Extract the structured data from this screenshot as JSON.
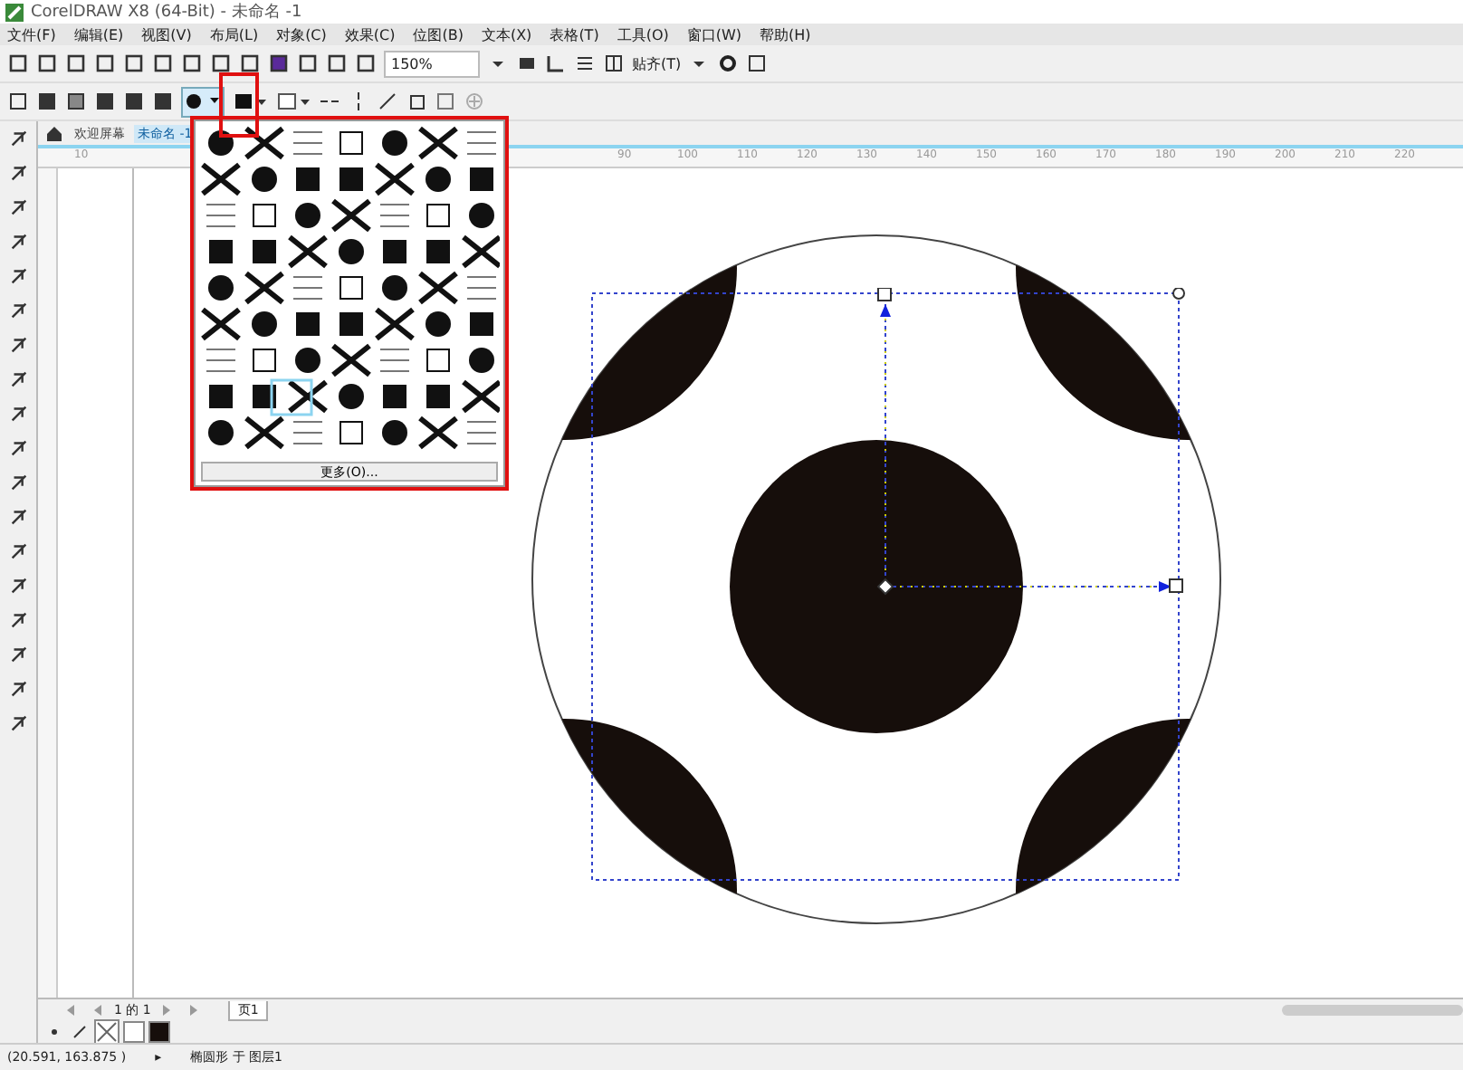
{
  "window": {
    "title": "CorelDRAW X8 (64-Bit) - 未命名 -1"
  },
  "menu": [
    "文件(F)",
    "编辑(E)",
    "视图(V)",
    "布局(L)",
    "对象(C)",
    "效果(C)",
    "位图(B)",
    "文本(X)",
    "表格(T)",
    "工具(O)",
    "窗口(W)",
    "帮助(H)"
  ],
  "standard_toolbar": {
    "zoom": "150%",
    "snap": "贴齐(T)"
  },
  "doc_tabs": [
    {
      "label": "欢迎屏幕",
      "selected": false
    },
    {
      "label": "未命名 -1",
      "selected": true
    }
  ],
  "ruler": [
    "10",
    "90",
    "100",
    "110",
    "120",
    "130",
    "140",
    "150",
    "160",
    "170",
    "180",
    "190",
    "200",
    "210",
    "220"
  ],
  "pattern_picker": {
    "more_button": "更多(O)..."
  },
  "page_nav": {
    "counter": "1 的 1",
    "page_tab": "页1"
  },
  "status_bar": {
    "coords": "(20.591, 163.875 )",
    "arrow": "▸",
    "object": "椭圆形 于 图层1"
  }
}
